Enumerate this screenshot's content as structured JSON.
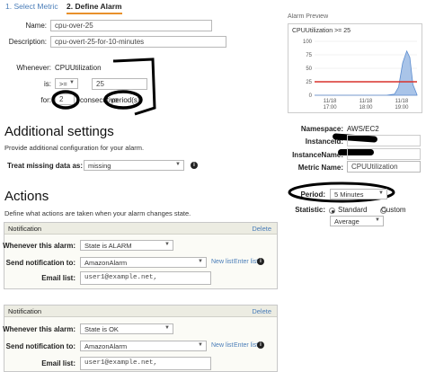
{
  "wizard": {
    "step1": "1. Select Metric",
    "step2": "2. Define Alarm"
  },
  "alarm": {
    "name_label": "Name:",
    "name_value": "cpu-over-25",
    "description_label": "Description:",
    "description_value": "cpu-overt-25-for-10-minutes"
  },
  "threshold": {
    "whenever_label": "Whenever:",
    "metric": "CPUUtilization",
    "is_label": "is:",
    "operator": ">=",
    "value": "25",
    "for_label": "for:",
    "periods_value": "2",
    "consecutive_label": "consecutive",
    "periods_label": "period(s)"
  },
  "additional": {
    "title": "Additional settings",
    "subtitle": "Provide additional configuration for your alarm.",
    "missing_label": "Treat missing data as:",
    "missing_value": "missing"
  },
  "actions": {
    "title": "Actions",
    "subtitle": "Define what actions are taken when your alarm changes state.",
    "notifications": [
      {
        "header": "Notification",
        "delete": "Delete",
        "state_label": "Whenever this alarm:",
        "state_value": "State is ALARM",
        "send_label": "Send notification to:",
        "topic": "AmazonAlarm",
        "new_list": "New list",
        "enter_list": "Enter list",
        "email_label": "Email list:",
        "email": "user1@example.net,"
      },
      {
        "header": "Notification",
        "delete": "Delete",
        "state_label": "Whenever this alarm:",
        "state_value": "State is OK",
        "send_label": "Send notification to:",
        "topic": "AmazonAlarm",
        "new_list": "New list",
        "enter_list": "Enter list",
        "email_label": "Email list:",
        "email": "user1@example.net,"
      }
    ]
  },
  "preview": {
    "header": "Alarm Preview",
    "chart_title": "CPUUtilization >= 25",
    "namespace_label": "Namespace:",
    "namespace_value": "AWS/EC2",
    "instanceid_label": "InstanceId:",
    "instancename_label": "InstanceName:",
    "metricname_label": "Metric Name:",
    "metricname_value": "CPUUtilization",
    "period_label": "Period:",
    "period_value": "5 Minutes",
    "statistic_label": "Statistic:",
    "stat_standard": "Standard",
    "stat_custom": "Custom",
    "stat_value": "Average"
  },
  "chart_data": {
    "type": "area",
    "title": "CPUUtilization >= 25",
    "x_ticks": [
      "11/18\n17:00",
      "11/18\n18:00",
      "11/18\n19:00"
    ],
    "y_ticks": [
      0,
      25,
      50,
      75,
      100
    ],
    "ylim": [
      0,
      100
    ],
    "threshold": 25,
    "series": [
      {
        "x": [
          0,
          0.1,
          0.2,
          0.3,
          0.4,
          0.5,
          0.6,
          0.7,
          0.78,
          0.82,
          0.86,
          0.9,
          0.93,
          0.96,
          1.0
        ],
        "values": [
          0,
          0,
          0,
          0,
          0,
          0,
          0,
          0,
          2,
          15,
          60,
          82,
          70,
          20,
          1
        ]
      }
    ],
    "colors": {
      "area": "#a9c4e8",
      "line": "#5b8ccf",
      "threshold": "#d9322b"
    }
  }
}
